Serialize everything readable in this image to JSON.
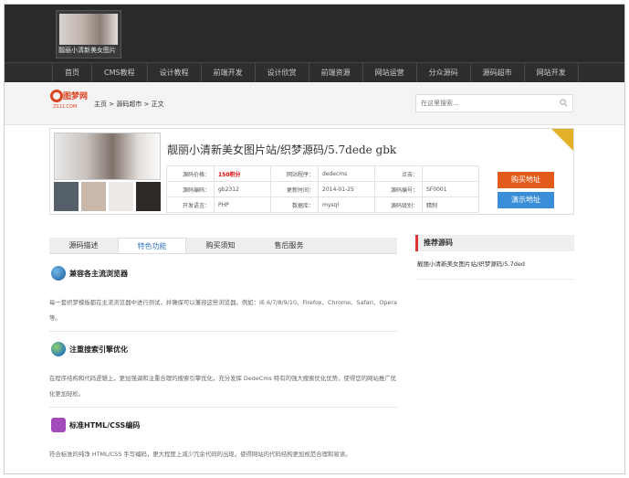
{
  "header": {
    "thumb_caption": "靓丽小清新美女图片"
  },
  "nav": {
    "items": [
      "首页",
      "CMS教程",
      "设计教程",
      "前端开发",
      "设计欣赏",
      "前端资源",
      "网站运营",
      "分众源码",
      "源码超市",
      "网站开发"
    ]
  },
  "logo": {
    "name": "图梦网",
    "url": "ZS12.COM"
  },
  "breadcrumb": "主页 > 源码超市 > 正文",
  "search": {
    "placeholder": "在这里搜索..."
  },
  "product": {
    "title": "靓丽小清新美女图片站/织梦源码/5.7dede gbk",
    "rows": [
      [
        {
          "k": "源码价格：",
          "v": "150积分",
          "price": true
        },
        {
          "k": "网站程序：",
          "v": "dedecms"
        },
        {
          "k": "点击：",
          "v": ""
        }
      ],
      [
        {
          "k": "源码编码：",
          "v": "gb2312"
        },
        {
          "k": "更新时间：",
          "v": "2014-01-25"
        },
        {
          "k": "源码编号：",
          "v": "SF0001"
        }
      ],
      [
        {
          "k": "开发语言：",
          "v": "PHP"
        },
        {
          "k": "数据库：",
          "v": "mysql"
        },
        {
          "k": "源码级别：",
          "v": "精制"
        }
      ]
    ],
    "buy_label": "购买地址",
    "demo_label": "演示地址"
  },
  "tabs": [
    "源码描述",
    "特色功能",
    "购买须知",
    "售后服务"
  ],
  "features": [
    {
      "title": "兼容各主流浏览器",
      "text": "每一套织梦模板都在主流浏览器中进行测试，并确保可以兼容这些浏览器。例如：IE 6/7/8/9/10、Firefox、Chrome、Safari、Opera等。"
    },
    {
      "title": "注重搜索引擎优化",
      "text": "在程序结构和代码逻辑上，更加强调和注重合理的搜索引擎优化，充分发挥 DedeCms 特有的强大搜索优化优势，使得您的网站推广优化更加轻松。"
    },
    {
      "title": "标准HTML/CSS编码",
      "text": "符合标准的纯净 HTML/CSS 手写编码，更大程度上减少冗余代码的出现，使得网站的代码结构更加规范合理和易读。"
    }
  ],
  "sidebar": {
    "heading": "推荐源码",
    "items": [
      "靓丽小清新美女图片站/织梦源码/5.7ded"
    ]
  },
  "colors": {
    "accent_red": "#d33",
    "buy": "#e35b1a",
    "demo": "#3a8ed8",
    "tab_active": "#3a7bbf"
  }
}
